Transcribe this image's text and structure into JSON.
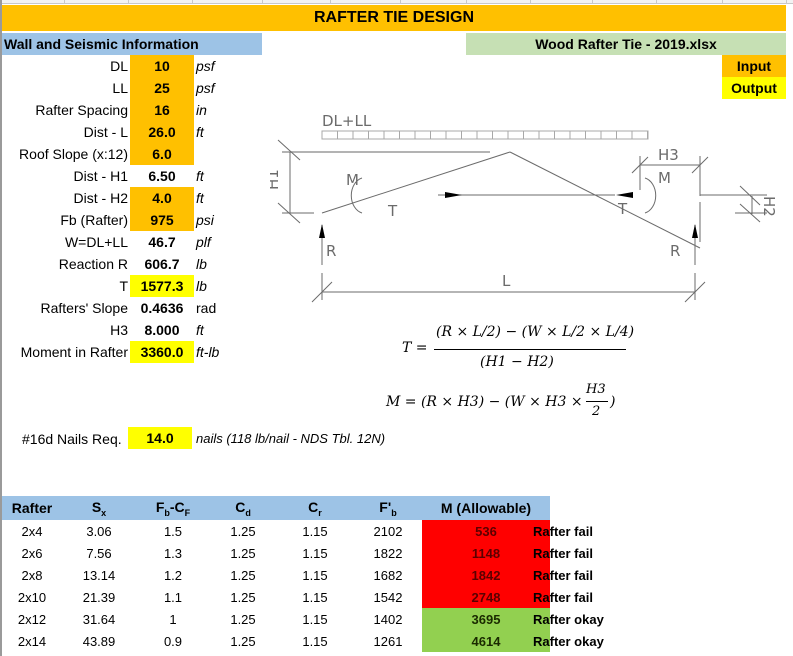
{
  "title": "RAFTER TIE DESIGN",
  "section_header": "Wall and Seismic Information",
  "file_name": "Wood Rafter Tie - 2019.xlsx",
  "legend": {
    "input": "Input",
    "output": "Output",
    "input_color": "#ffc000",
    "output_color": "#ffff00"
  },
  "params": [
    {
      "label": "DL",
      "value": "10",
      "unit": "psf",
      "type": "input"
    },
    {
      "label": "LL",
      "value": "25",
      "unit": "psf",
      "type": "input"
    },
    {
      "label": "Rafter Spacing",
      "value": "16",
      "unit": "in",
      "type": "input"
    },
    {
      "label": "Dist - L",
      "value": "26.0",
      "unit": "ft",
      "type": "input"
    },
    {
      "label": "Roof Slope (x:12)",
      "value": "6.0",
      "unit": "",
      "type": "input"
    },
    {
      "label": "Dist - H1",
      "value": "6.50",
      "unit": "ft",
      "type": "calc"
    },
    {
      "label": "Dist - H2",
      "value": "4.0",
      "unit": "ft",
      "type": "input"
    },
    {
      "label": "Fb (Rafter)",
      "value": "975",
      "unit": "psi",
      "type": "input"
    },
    {
      "label": "W=DL+LL",
      "value": "46.7",
      "unit": "plf",
      "type": "calc"
    },
    {
      "label": "Reaction R",
      "value": "606.7",
      "unit": "lb",
      "type": "calc"
    },
    {
      "label": "T",
      "value": "1577.3",
      "unit": "lb",
      "type": "output"
    },
    {
      "label": "Rafters' Slope",
      "value": "0.4636",
      "unit": "rad",
      "type": "calc"
    },
    {
      "label": "H3",
      "value": "8.000",
      "unit": "ft",
      "type": "calc"
    },
    {
      "label": "Moment in Rafter",
      "value": "3360.0",
      "unit": "ft-lb",
      "type": "output"
    }
  ],
  "nails": {
    "label": "#16d Nails Req.",
    "value": "14.0",
    "unit": "nails (118 lb/nail - NDS Tbl. 12N)"
  },
  "diagram": {
    "load_label": "DL+LL",
    "labels": {
      "h1": "H1",
      "h2": "H2",
      "h3": "H3",
      "m": "M",
      "t": "T",
      "r": "R",
      "l": "L"
    }
  },
  "formulas": {
    "t_lhs": "T =",
    "t_num": "(R × L/2) − (W × L/2 × L/4)",
    "t_den": "(H1 − H2)",
    "m_lhs": "M = (R × H3) − (W × H3 ×",
    "m_frac_num": "H3",
    "m_frac_den": "2",
    "m_close": ")"
  },
  "table": {
    "headers": [
      "Rafter",
      "S",
      "F",
      "C",
      "C",
      "F'",
      "M (Allowable)"
    ],
    "header_subs": [
      "",
      "x",
      "b",
      "d",
      "r",
      "b",
      ""
    ],
    "header_extra": [
      "",
      "",
      "-C",
      "",
      "",
      "",
      ""
    ],
    "header_extra_sub": [
      "",
      "",
      "F",
      "",
      "",
      "",
      ""
    ],
    "rows": [
      {
        "rafter": "2x4",
        "sx": "3.06",
        "fbcf": "1.5",
        "cd": "1.25",
        "cr": "1.15",
        "fb": "2102",
        "m": "536",
        "status": "Rafter fail",
        "ok": false
      },
      {
        "rafter": "2x6",
        "sx": "7.56",
        "fbcf": "1.3",
        "cd": "1.25",
        "cr": "1.15",
        "fb": "1822",
        "m": "1148",
        "status": "Rafter fail",
        "ok": false
      },
      {
        "rafter": "2x8",
        "sx": "13.14",
        "fbcf": "1.2",
        "cd": "1.25",
        "cr": "1.15",
        "fb": "1682",
        "m": "1842",
        "status": "Rafter fail",
        "ok": false
      },
      {
        "rafter": "2x10",
        "sx": "21.39",
        "fbcf": "1.1",
        "cd": "1.25",
        "cr": "1.15",
        "fb": "1542",
        "m": "2748",
        "status": "Rafter fail",
        "ok": false
      },
      {
        "rafter": "2x12",
        "sx": "31.64",
        "fbcf": "1",
        "cd": "1.25",
        "cr": "1.15",
        "fb": "1402",
        "m": "3695",
        "status": "Rafter okay",
        "ok": true
      },
      {
        "rafter": "2x14",
        "sx": "43.89",
        "fbcf": "0.9",
        "cd": "1.25",
        "cr": "1.15",
        "fb": "1261",
        "m": "4614",
        "status": "Rafter okay",
        "ok": true
      }
    ],
    "fail_color": "#ff0000",
    "okay_color": "#92d050"
  }
}
